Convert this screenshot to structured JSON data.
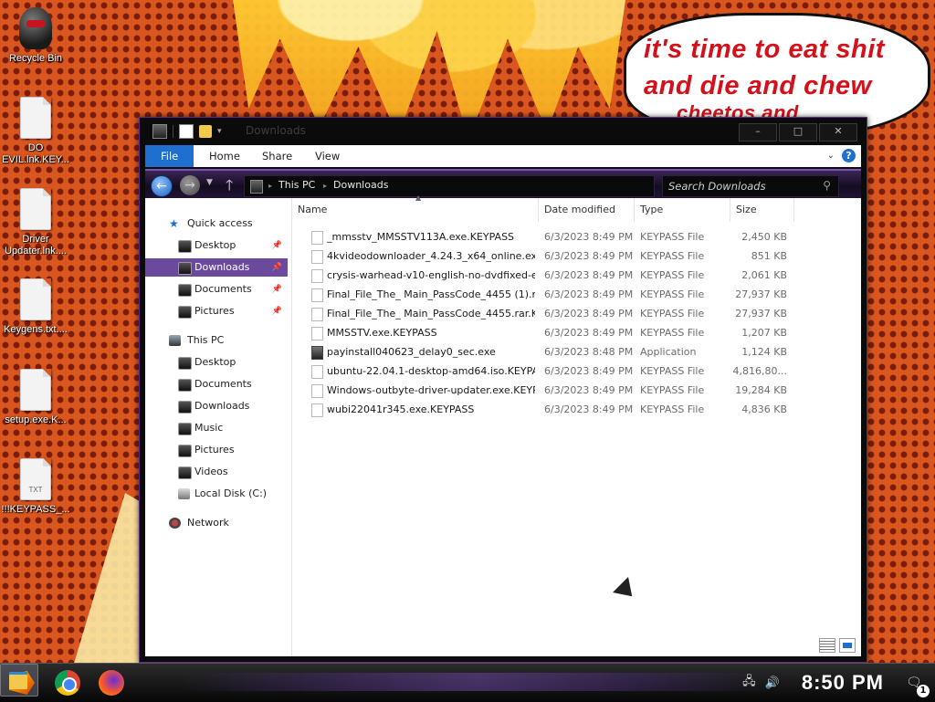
{
  "wallpaper": {
    "speech_lines": [
      "it's time to eat shit",
      "and die and chew",
      "cheetos and"
    ]
  },
  "desktop_icons": [
    {
      "label": "Recycle Bin",
      "icon": "recycle-bin-icon"
    },
    {
      "label": "DO EVIL.lnk.KEY...",
      "icon": "document-icon"
    },
    {
      "label": "Driver Updater.lnk....",
      "icon": "document-icon"
    },
    {
      "label": "Keygens.txt....",
      "icon": "document-icon"
    },
    {
      "label": "setup.exe.K...",
      "icon": "document-icon"
    },
    {
      "label": "!!!KEYPASS_...",
      "icon": "text-document-icon",
      "badge": "TXT"
    }
  ],
  "window": {
    "title": "Downloads",
    "controls": {
      "minimize": "–",
      "maximize": "□",
      "close": "✕"
    },
    "ribbon": {
      "tabs": [
        "File",
        "Home",
        "Share",
        "View"
      ],
      "expand": "⌄",
      "help": "?"
    },
    "address": {
      "crumbs": [
        "This PC",
        "Downloads"
      ]
    },
    "search": {
      "placeholder": "Search Downloads",
      "icon": "⚲"
    },
    "nav_pane": {
      "quick_access": "Quick access",
      "quick_items": [
        "Desktop",
        "Downloads",
        "Documents",
        "Pictures"
      ],
      "this_pc": "This PC",
      "pc_items": [
        "Desktop",
        "Documents",
        "Downloads",
        "Music",
        "Pictures",
        "Videos",
        "Local Disk (C:)"
      ],
      "network": "Network"
    },
    "columns": {
      "name": "Name",
      "date": "Date modified",
      "type": "Type",
      "size": "Size"
    },
    "files": [
      {
        "name": "_mmsstv_MMSSTV113A.exe.KEYPASS",
        "date": "6/3/2023 8:49 PM",
        "type": "KEYPASS File",
        "size": "2,450 KB"
      },
      {
        "name": "4kvideodownloader_4.24.3_x64_online.exe....",
        "date": "6/3/2023 8:49 PM",
        "type": "KEYPASS File",
        "size": "851 KB"
      },
      {
        "name": "crysis-warhead-v10-english-no-dvdfixed-ex...",
        "date": "6/3/2023 8:49 PM",
        "type": "KEYPASS File",
        "size": "2,061 KB"
      },
      {
        "name": "Final_File_The_ Main_PassCode_4455 (1).ra...",
        "date": "6/3/2023 8:49 PM",
        "type": "KEYPASS File",
        "size": "27,937 KB"
      },
      {
        "name": "Final_File_The_ Main_PassCode_4455.rar.K...",
        "date": "6/3/2023 8:49 PM",
        "type": "KEYPASS File",
        "size": "27,937 KB"
      },
      {
        "name": "MMSSTV.exe.KEYPASS",
        "date": "6/3/2023 8:49 PM",
        "type": "KEYPASS File",
        "size": "1,207 KB"
      },
      {
        "name": "payinstall040623_delay0_sec.exe",
        "date": "6/3/2023 8:48 PM",
        "type": "Application",
        "size": "1,124 KB",
        "app": true
      },
      {
        "name": "ubuntu-22.04.1-desktop-amd64.iso.KEYPASS",
        "date": "6/3/2023 8:49 PM",
        "type": "KEYPASS File",
        "size": "4,816,80..."
      },
      {
        "name": "Windows-outbyte-driver-updater.exe.KEYPASS",
        "date": "6/3/2023 8:49 PM",
        "type": "KEYPASS File",
        "size": "19,284 KB"
      },
      {
        "name": "wubi22041r345.exe.KEYPASS",
        "date": "6/3/2023 8:49 PM",
        "type": "KEYPASS File",
        "size": "4,836 KB"
      }
    ]
  },
  "taskbar": {
    "clock": "8:50 PM",
    "notification_count": "1",
    "tray_icons": [
      "network-icon",
      "volume-icon"
    ]
  },
  "colors": {
    "accent": "#6b4a9e",
    "file_tab": "#1f6fd1",
    "speech_text": "#d4111a"
  }
}
